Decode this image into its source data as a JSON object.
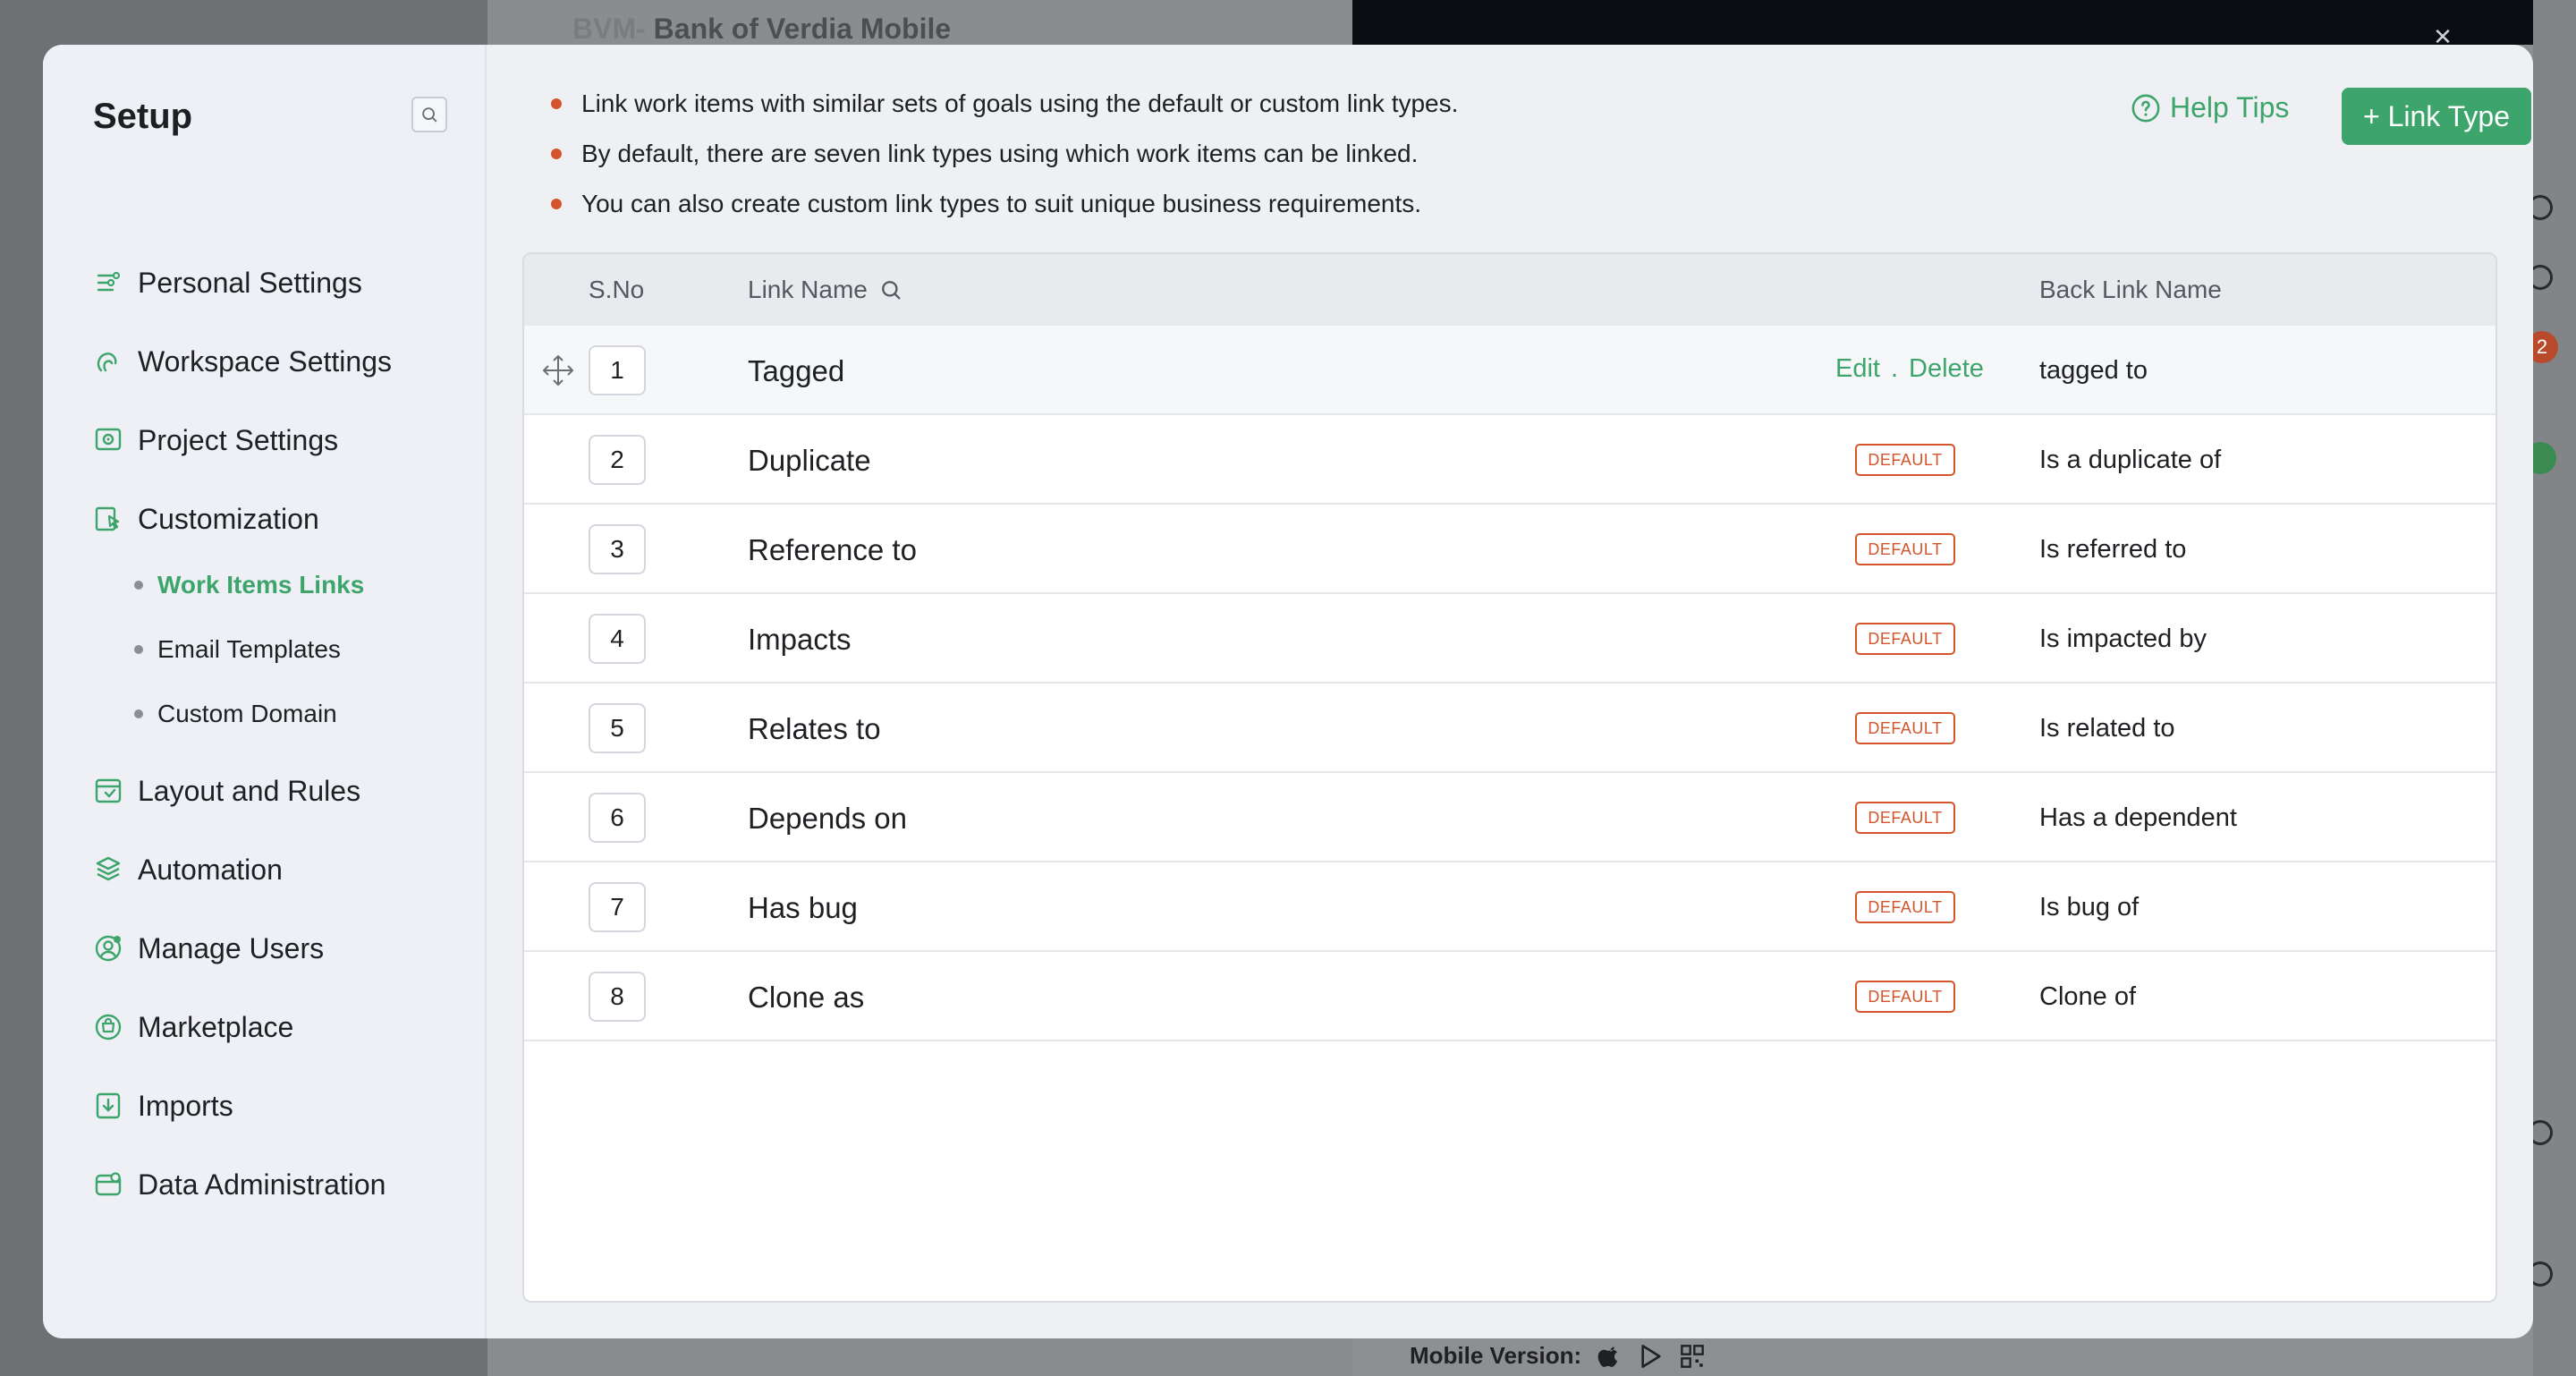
{
  "background": {
    "project_prefix": "BVM-",
    "project_title": "Bank of Verdia Mobile",
    "mobile_version_label": "Mobile Version:",
    "notification_count": "2"
  },
  "sidebar": {
    "title": "Setup",
    "items": [
      {
        "label": "Personal Settings",
        "icon": "personal-settings-icon"
      },
      {
        "label": "Workspace Settings",
        "icon": "workspace-settings-icon"
      },
      {
        "label": "Project Settings",
        "icon": "project-settings-icon"
      },
      {
        "label": "Customization",
        "icon": "customization-icon"
      },
      {
        "label": "Layout and Rules",
        "icon": "layout-rules-icon"
      },
      {
        "label": "Automation",
        "icon": "automation-icon"
      },
      {
        "label": "Manage Users",
        "icon": "manage-users-icon"
      },
      {
        "label": "Marketplace",
        "icon": "marketplace-icon"
      },
      {
        "label": "Imports",
        "icon": "imports-icon"
      },
      {
        "label": "Data Administration",
        "icon": "data-administration-icon"
      }
    ],
    "customization_sub": [
      {
        "label": "Work Items Links",
        "active": true
      },
      {
        "label": "Email Templates",
        "active": false
      },
      {
        "label": "Custom Domain",
        "active": false
      }
    ]
  },
  "info": {
    "bullets": [
      "Link work items with similar sets of goals using the default or custom link types.",
      "By default, there are seven link types using which work items can be linked.",
      "You can also create custom link types to suit unique business requirements."
    ]
  },
  "toolbar": {
    "help_label": "Help Tips",
    "add_label": "+ Link Type"
  },
  "table": {
    "headers": {
      "sno": "S.No",
      "name": "Link Name",
      "back": "Back Link Name"
    },
    "edit_label": "Edit",
    "separator": ".",
    "delete_label": "Delete",
    "default_label": "DEFAULT",
    "rows": [
      {
        "sno": "1",
        "name": "Tagged",
        "back": "tagged to",
        "is_default": false
      },
      {
        "sno": "2",
        "name": "Duplicate",
        "back": "Is a duplicate of",
        "is_default": true
      },
      {
        "sno": "3",
        "name": "Reference to",
        "back": "Is referred to",
        "is_default": true
      },
      {
        "sno": "4",
        "name": "Impacts",
        "back": "Is impacted by",
        "is_default": true
      },
      {
        "sno": "5",
        "name": "Relates to",
        "back": "Is related to",
        "is_default": true
      },
      {
        "sno": "6",
        "name": "Depends on",
        "back": "Has a dependent",
        "is_default": true
      },
      {
        "sno": "7",
        "name": "Has bug",
        "back": "Is bug of",
        "is_default": true
      },
      {
        "sno": "8",
        "name": "Clone as",
        "back": "Clone of",
        "is_default": true
      }
    ]
  },
  "colors": {
    "accent_green": "#3da56b",
    "accent_red": "#d4552c"
  }
}
